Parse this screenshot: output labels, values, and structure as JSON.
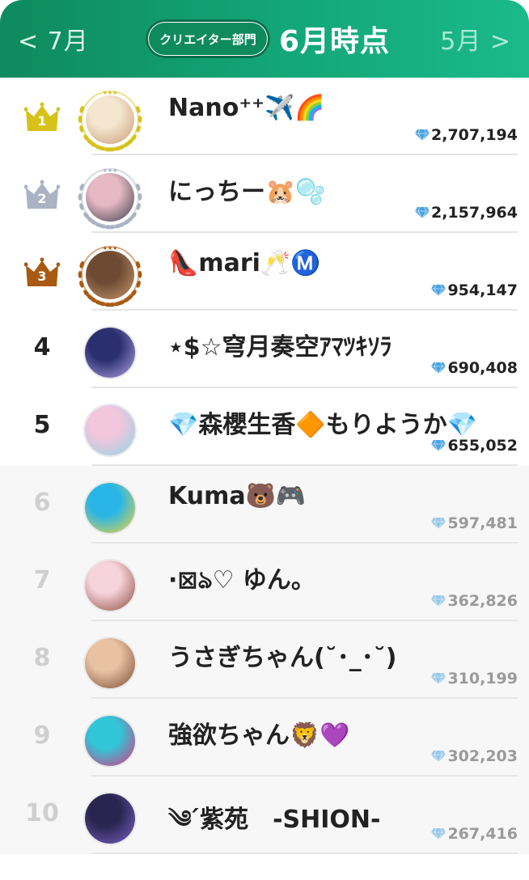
{
  "header": {
    "prev_label": "< 7月",
    "next_label": "5月 >",
    "category_badge": "クリエイター部門",
    "period_label": "6月時点"
  },
  "ranking": [
    {
      "rank": "1",
      "name": "Nano⁺⁺✈️🌈",
      "score": "2,707,194",
      "medal": "gold",
      "avatar_colors": [
        "#f4e6d0",
        "#c79c74"
      ]
    },
    {
      "rank": "2",
      "name": "にっちー🐹🫧",
      "score": "2,157,964",
      "medal": "silver",
      "avatar_colors": [
        "#e7b9c6",
        "#3a3f48"
      ]
    },
    {
      "rank": "3",
      "name": "👠mari🥂Ⓜ️",
      "score": "954,147",
      "medal": "bronze",
      "avatar_colors": [
        "#6e4a33",
        "#c89a6d"
      ]
    },
    {
      "rank": "4",
      "name": "⋆$☆穹月奏空ｱﾏﾂｷｿﾗ",
      "score": "690,408",
      "medal": "",
      "avatar_colors": [
        "#2a2f6e",
        "#b5a3e6"
      ]
    },
    {
      "rank": "5",
      "name": "💎森櫻生香🔶もりようか💎",
      "score": "655,052",
      "medal": "",
      "avatar_colors": [
        "#f2c6dc",
        "#8fd4e8"
      ]
    },
    {
      "rank": "6",
      "name": "Kuma🐻🎮",
      "score": "597,481",
      "medal": "",
      "avatar_colors": [
        "#29b6e6",
        "#f5d33b"
      ]
    },
    {
      "rank": "7",
      "name": "·⊠ঌ♡ ゆん。",
      "score": "362,826",
      "medal": "",
      "avatar_colors": [
        "#f7d3dc",
        "#8a4a3a"
      ]
    },
    {
      "rank": "8",
      "name": "うさぎちゃん(˘･_･˘)",
      "score": "310,199",
      "medal": "",
      "avatar_colors": [
        "#e9c2a4",
        "#7a4b35"
      ]
    },
    {
      "rank": "9",
      "name": "強欲ちゃん🦁💜",
      "score": "302,203",
      "medal": "",
      "avatar_colors": [
        "#30c6d8",
        "#e3317c"
      ]
    },
    {
      "rank": "10",
      "name": "༄ ́紫苑　-SHION-",
      "score": "267,416",
      "medal": "",
      "avatar_colors": [
        "#2a2550",
        "#7c63c9"
      ]
    }
  ],
  "colors": {
    "header_start": "#0e8a5f",
    "header_end": "#1bb98a",
    "gold": "#d7c21a",
    "silver": "#a9b3c4",
    "bronze": "#a95a12",
    "gem": "#4aa3e0"
  }
}
